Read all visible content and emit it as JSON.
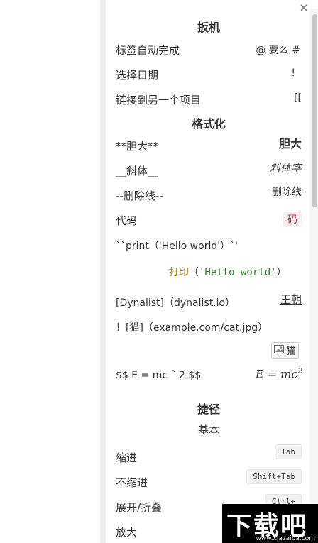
{
  "sections": {
    "triggers_heading": "扳机",
    "formatting_heading": "格式化",
    "shortcuts_heading": "捷径",
    "shortcuts_sub": "基本"
  },
  "triggers": [
    {
      "label": "标签自动完成",
      "value": "@ 要么 #"
    },
    {
      "label": "选择日期",
      "value": "!"
    },
    {
      "label": "链接到另一个项目",
      "value": "[["
    }
  ],
  "formatting": {
    "bold": {
      "syntax": "**胆大**",
      "preview": "胆大"
    },
    "italic": {
      "syntax": "__斜体__",
      "preview": "斜体字"
    },
    "strike": {
      "syntax": "--删除线--",
      "preview": "删除线"
    },
    "code": {
      "label": "代码",
      "preview": "码"
    },
    "code_block": {
      "syntax": "``print（'Hello world'）`'",
      "keyword": "打印",
      "paren_open": "（",
      "string": "'Hello world'",
      "paren_close": "）"
    },
    "link": {
      "syntax": "[Dynalist]（dynalist.io）",
      "preview": "王朝"
    },
    "image": {
      "syntax": "！[猫]（example.com/cat.jpg）",
      "preview": "猫"
    },
    "latex": {
      "syntax": "$$ E = mc ˆ 2 $$",
      "preview": "E = mc",
      "exponent": "2"
    }
  },
  "shortcuts": [
    {
      "label": "缩进",
      "key": "Tab"
    },
    {
      "label": "不缩进",
      "key": "Shift+Tab"
    },
    {
      "label": "展开/折叠",
      "key": "Ctrl+"
    },
    {
      "label": "放大",
      "key": ""
    }
  ],
  "watermark": {
    "title": "下载吧",
    "url": "www.xiazaiba.com"
  },
  "icons": {
    "close": "close-icon",
    "image": "image-icon"
  }
}
